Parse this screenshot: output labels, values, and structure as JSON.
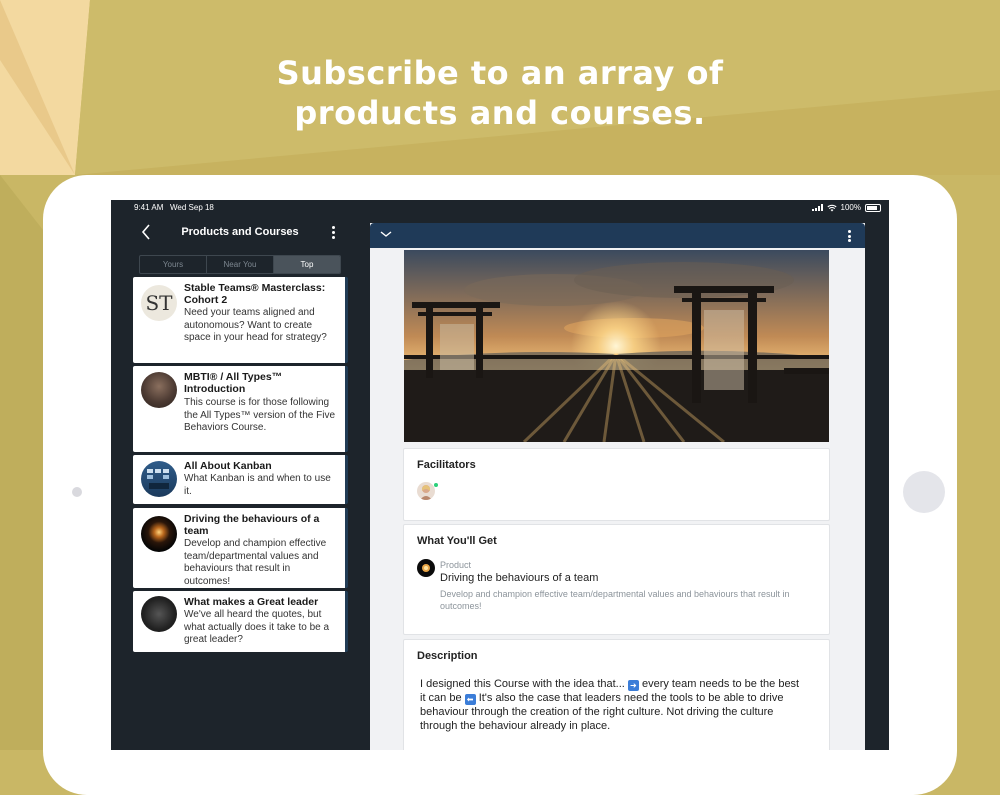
{
  "headline": {
    "line1": "Subscribe to an array of",
    "line2": "products and courses."
  },
  "status_bar": {
    "time": "9:41 AM",
    "date": "Wed Sep 18",
    "battery": "100%"
  },
  "left_panel": {
    "title": "Products and Courses",
    "back_icon": "chevron-left-icon",
    "menu_icon": "kebab-menu-icon",
    "tabs": [
      {
        "label": "Yours",
        "active": false
      },
      {
        "label": "Near You",
        "active": false
      },
      {
        "label": "Top",
        "active": true
      }
    ],
    "courses": [
      {
        "thumb_text": "ST",
        "title": "Stable Teams® Masterclass: Cohort 2",
        "description": "Need your teams aligned and autonomous? Want to create space in your head for strategy?"
      },
      {
        "title": "MBTI® / All Types™ Introduction",
        "description": "This course is for those following the All Types™ version of the Five Behaviors Course."
      },
      {
        "title": "All About Kanban",
        "description": "What Kanban is and when to use it."
      },
      {
        "title": "Driving the behaviours of a team",
        "description": "Develop and champion effective team/departmental values and behaviours that result in outcomes!"
      },
      {
        "title": "What makes a Great leader",
        "description": "We've all heard the quotes, but what actually does it take to be a great leader?"
      }
    ]
  },
  "right_panel": {
    "collapse_icon": "chevron-down-icon",
    "menu_icon": "kebab-menu-icon",
    "facilitators": {
      "title": "Facilitators"
    },
    "what_youll_get": {
      "title": "What You'll Get",
      "item_kind": "Product",
      "item_name": "Driving the behaviours of a team",
      "item_description": "Develop and champion effective team/departmental values and behaviours that result in outcomes!"
    },
    "description": {
      "title": "Description",
      "text_part1": "I designed this Course with the idea that... ",
      "text_part2": " every team needs to be the best it can be ",
      "text_part3": "  It's also the case that leaders need the tools to be able to drive behaviour through the creation of the right culture.  Not driving the culture through the behaviour already in place."
    }
  },
  "colors": {
    "background": "#c9b765",
    "screen_dark": "#1d242b",
    "header_navy": "#1f3a58",
    "card_accent": "#213c55",
    "online": "#2bd07a"
  }
}
